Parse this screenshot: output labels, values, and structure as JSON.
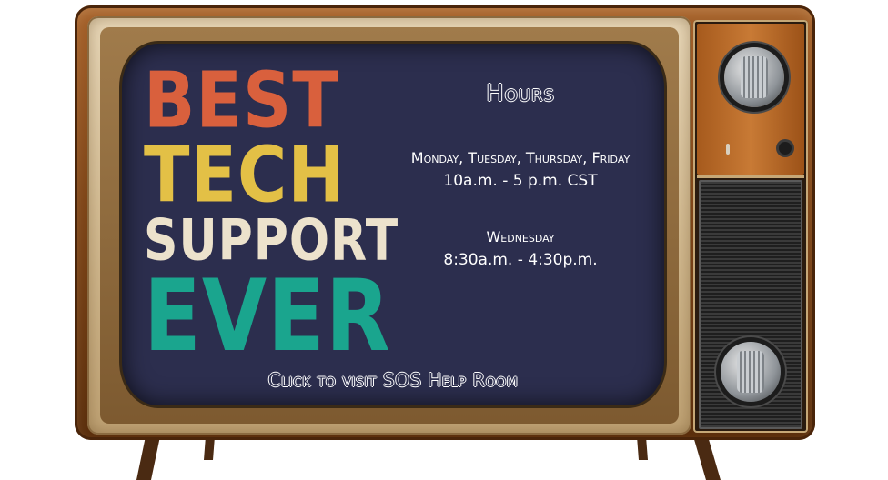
{
  "slogan": {
    "line1": "BEST",
    "line2": "TECH",
    "line3": "SUPPORT",
    "line4": "EVER"
  },
  "hours": {
    "title": "Hours",
    "weekdays": "Monday, Tuesday, Thursday, Friday",
    "weekdays_time": "10a.m. - 5 p.m. CST",
    "wednesday": "Wednesday",
    "wednesday_time": "8:30a.m. - 4:30p.m."
  },
  "link": {
    "visit": "Click to visit SOS Help Room"
  },
  "colors": {
    "screen": "#2c2e4e",
    "best": "#d9603d",
    "tech": "#e3c046",
    "support": "#ece2cc",
    "ever": "#1aa58e",
    "cabinet": "#7e4518"
  },
  "icons": {
    "top_knob": "tuner-knob-icon",
    "bottom_knob": "volume-knob-icon",
    "speaker": "speaker-grille-icon"
  }
}
